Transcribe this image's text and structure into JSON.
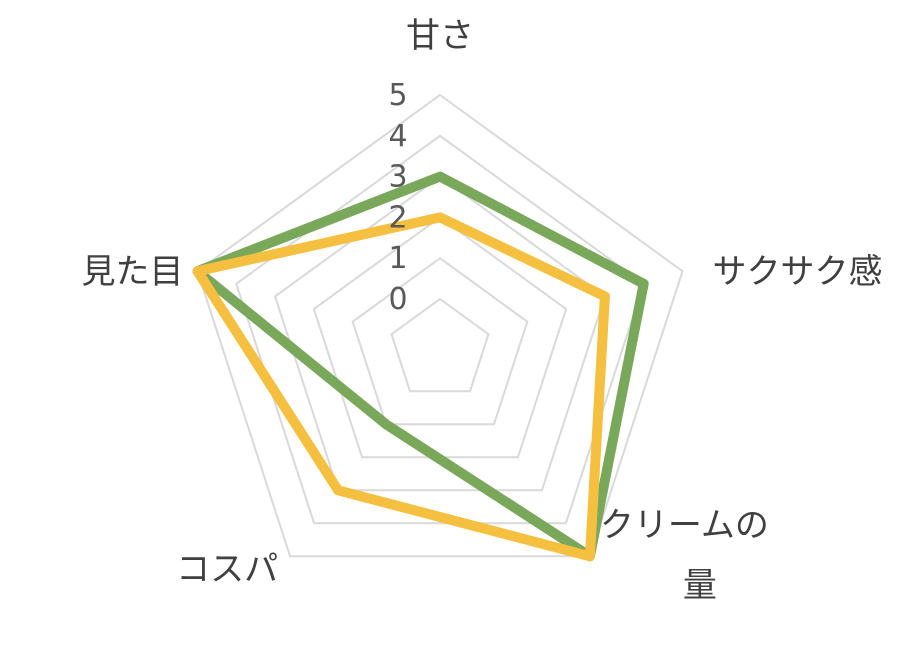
{
  "chart_data": {
    "type": "radar",
    "title": "",
    "axes": [
      "甘さ",
      "サクサク感",
      "クリームの量",
      "コスパ",
      "見た目"
    ],
    "axis_label_lines": [
      [
        "甘さ"
      ],
      [
        "サクサク感"
      ],
      [
        "クリームの",
        "量"
      ],
      [
        "コスパ"
      ],
      [
        "見た目"
      ]
    ],
    "range": [
      0,
      5
    ],
    "ticks": [
      "0",
      "1",
      "2",
      "3",
      "4",
      "5"
    ],
    "grid": true,
    "legend": "none",
    "series": [
      {
        "values": [
          3,
          4,
          5,
          1,
          5
        ],
        "color": "#7AA85A"
      },
      {
        "values": [
          2,
          3,
          5,
          3,
          5
        ],
        "color": "#F5BF40"
      }
    ]
  }
}
